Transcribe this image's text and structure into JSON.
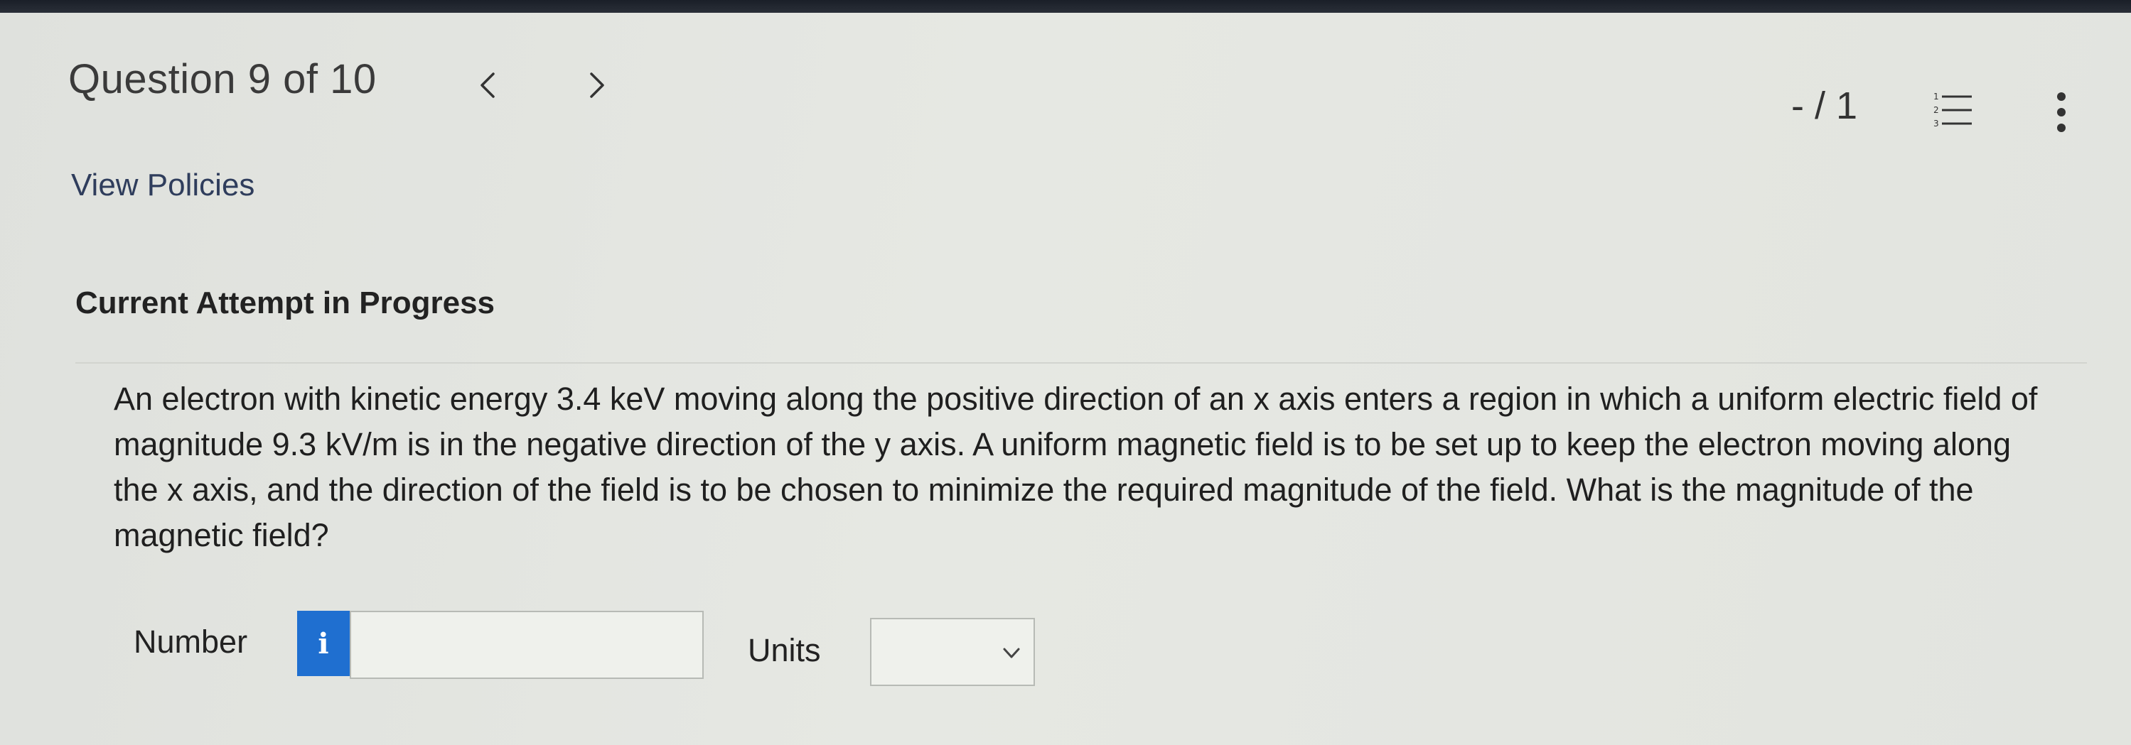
{
  "header": {
    "question_title": "Question 9 of 10",
    "score": "- / 1"
  },
  "icons": {
    "prev": "chevron-left-icon",
    "next": "chevron-right-icon",
    "list": "numbered-list-icon",
    "more": "vertical-dots-icon",
    "info": "info-icon"
  },
  "links": {
    "view_policies": "View Policies"
  },
  "attempt_heading": "Current Attempt in Progress",
  "question_text": "An electron with kinetic energy 3.4 keV moving along the positive direction of an x axis enters a region in which a uniform electric field of magnitude 9.3 kV/m is in the negative direction of the y axis. A uniform magnetic field is to be set up to keep the electron moving along the x axis, and the direction of the field is to be chosen to minimize the required magnitude of the field. What is the magnitude of the magnetic field?",
  "answer": {
    "number_label": "Number",
    "info_glyph": "i",
    "number_value": "",
    "units_label": "Units",
    "units_selected": ""
  },
  "colors": {
    "info_button": "#1f6fd0",
    "link": "#2f3d5c"
  }
}
